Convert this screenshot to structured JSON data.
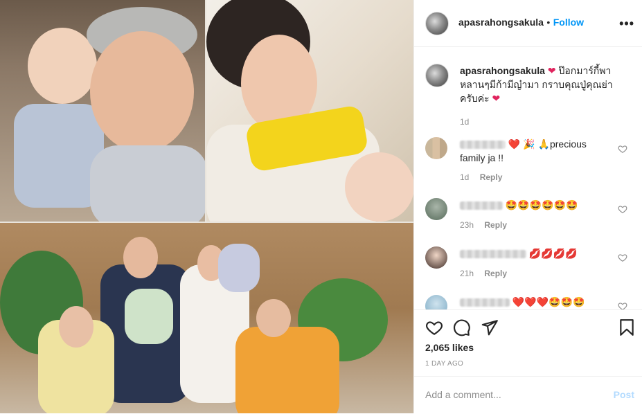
{
  "post": {
    "username": "apasrahongsakula",
    "follow_label": "Follow",
    "separator": "•",
    "more_label": "•••",
    "caption_user": "apasrahongsakula",
    "caption_text": "ป๊อกมาร์กี้พาหลานๆมีก้ามีญ๋ามา กราบคุณปู่คุณย่าครับค่ะ",
    "caption_time": "1d",
    "likes": "2,065 likes",
    "date": "1 DAY AGO",
    "add_comment_placeholder": "Add a comment...",
    "post_label": "Post"
  },
  "comments": [
    {
      "text": "🙏precious family ja !!",
      "emoji_prefix": "❤️ 🎉 ",
      "time": "1d",
      "reply": "Reply"
    },
    {
      "text": "🤩🤩🤩🤩🤩🤩",
      "time": "23h",
      "reply": "Reply"
    },
    {
      "text": "💋💋💋💋",
      "time": "21h",
      "reply": "Reply"
    },
    {
      "text": "❤️❤️❤️🤩🤩🤩",
      "time": "",
      "reply": ""
    }
  ],
  "colors": {
    "link": "#0095f6",
    "muted": "#8e8e8e",
    "border": "#efefef"
  },
  "icons": [
    "more-icon",
    "heart-icon",
    "comment-icon",
    "share-icon",
    "bookmark-icon"
  ]
}
